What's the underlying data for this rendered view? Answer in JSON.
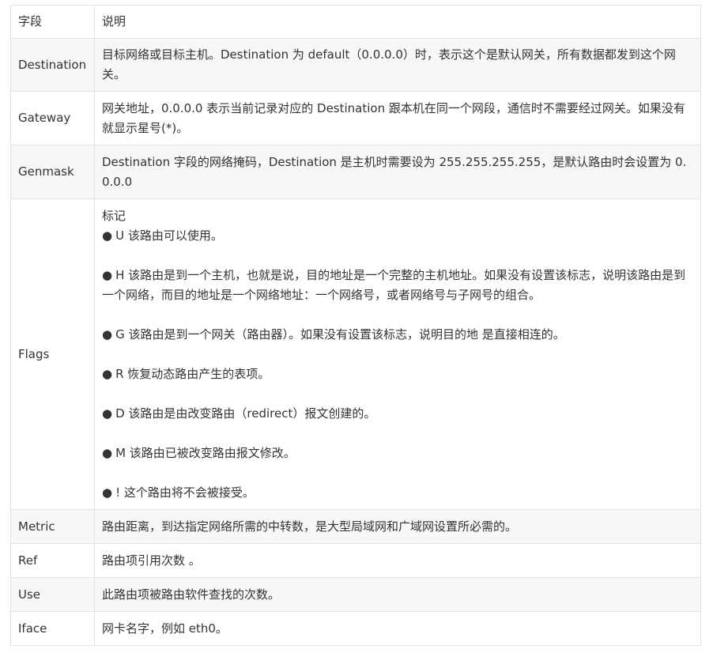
{
  "table": {
    "headers": [
      "字段",
      "说明"
    ],
    "rows": [
      {
        "field": "Destination",
        "desc": "目标网络或目标主机。Destination 为 default（0.0.0.0）时，表示这个是默认网关，所有数据都发到这个网关。"
      },
      {
        "field": "Gateway",
        "desc": "网关地址，0.0.0.0 表示当前记录对应的 Destination 跟本机在同一个网段，通信时不需要经过网关。如果没有就显示星号(*)。"
      },
      {
        "field": "Genmask",
        "desc": "Destination 字段的网络掩码，Destination 是主机时需要设为 255.255.255.255，是默认路由时会设置为 0.0.0.0"
      },
      {
        "field": "Flags",
        "desc": "标记"
      },
      {
        "field": "Metric",
        "desc": "路由距离，到达指定网络所需的中转数，是大型局域网和广域网设置所必需的。"
      },
      {
        "field": "Ref",
        "desc": "路由项引用次数 。"
      },
      {
        "field": "Use",
        "desc": "此路由项被路由软件查找的次数。"
      },
      {
        "field": "Iface",
        "desc": "网卡名字，例如 eth0。"
      }
    ],
    "flags": {
      "bullet": "●",
      "items": [
        "U 该路由可以使用。",
        "H 该路由是到一个主机，也就是说，目的地址是一个完整的主机地址。如果没有设置该标志，说明该路由是到一个网络，而目的地址是一个网络地址：一个网络号，或者网络号与子网号的组合。",
        "G 该路由是到一个网关（路由器）。如果没有设置该标志，说明目的地 是直接相连的。",
        "R 恢复动态路由产生的表项。",
        "D 该路由是由改变路由（redirect）报文创建的。",
        "M 该路由已被改变路由报文修改。",
        "! 这个路由将不会被接受。"
      ]
    }
  }
}
